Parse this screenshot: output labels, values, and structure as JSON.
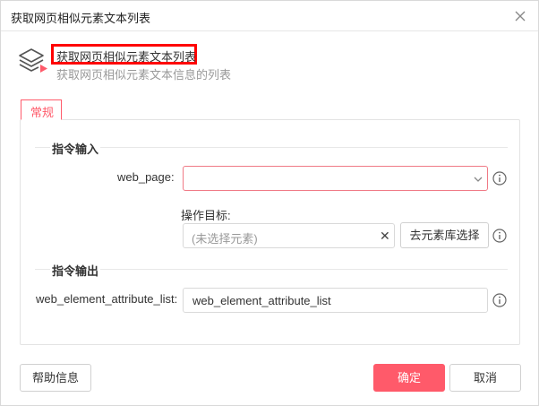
{
  "dialog": {
    "title": "获取网页相似元素文本列表",
    "close_icon": "close-icon"
  },
  "header": {
    "icon": "layers-play-icon",
    "title": "获取网页相似元素文本列表",
    "description": "获取网页相似元素文本信息的列表",
    "highlight_color": "#ff0000"
  },
  "tabs": [
    {
      "label": "常规",
      "active": true
    }
  ],
  "sections": {
    "input": {
      "heading": "指令输入",
      "web_page": {
        "label": "web_page:",
        "value": "",
        "icon": "chevron-down-icon"
      },
      "target": {
        "label": "操作目标:",
        "placeholder": "(未选择元素)",
        "clear_glyph": "✕",
        "repo_button": "去元素库选择"
      }
    },
    "output": {
      "heading": "指令输出",
      "list": {
        "label": "web_element_attribute_list:",
        "value": "web_element_attribute_list"
      }
    }
  },
  "footer": {
    "help_label": "帮助信息",
    "ok_label": "确定",
    "cancel_label": "取消"
  },
  "colors": {
    "accent": "#ff5a6a",
    "border": "#d9d9d9"
  }
}
